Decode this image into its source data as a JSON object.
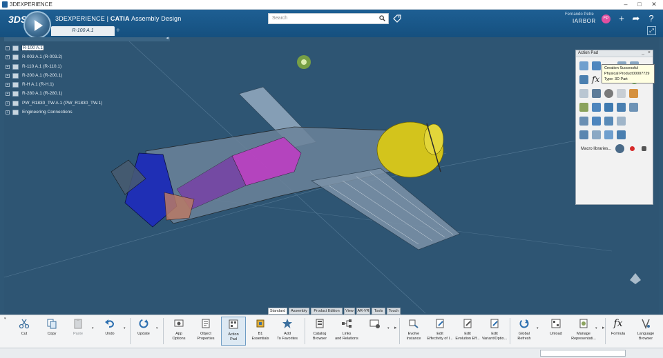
{
  "window": {
    "title": "3DEXPERIENCE"
  },
  "header": {
    "brand": "3DEXPERIENCE",
    "app_sep": " | ",
    "app": "CATIA",
    "app_module": "Assembly Design",
    "search_placeholder": "Search",
    "user_name": "Fernando Petre",
    "user_context": "IARBOR",
    "avatar_initials": "FP"
  },
  "tabs": [
    {
      "label": "R-100 A.1"
    }
  ],
  "tree": {
    "items": [
      {
        "label": "R-100 A.1",
        "selected": true
      },
      {
        "label": "R-003 A.1 (R-003.2)"
      },
      {
        "label": "R-110 A.1 (R-110.1)"
      },
      {
        "label": "R-200 A.1 (R-200.1)"
      },
      {
        "label": "R-H A.1 (R-H.1)"
      },
      {
        "label": "R-280 A.1 (R-280.1)"
      },
      {
        "label": "PW_R1830_TW A.1 (PW_R1830_TW.1)"
      },
      {
        "label": "Engineering Connections"
      }
    ]
  },
  "action_pad": {
    "title": "Action Pad",
    "macro_label": "Macro libraries...",
    "tooltip": [
      "Creation Successful",
      "Physical Product00007729",
      "Type: 3D Part"
    ]
  },
  "bottom_tabs": [
    "Standard",
    "Assembly",
    "Product Edition",
    "View",
    "AR-VR",
    "Tools",
    "Touch"
  ],
  "active_bottom_tab": "Standard",
  "toolbar": {
    "items": [
      {
        "label": "Cut",
        "icon": "scissors-icon"
      },
      {
        "label": "Copy",
        "icon": "copy-icon"
      },
      {
        "label": "Paste",
        "icon": "paste-icon",
        "disabled": true
      },
      {
        "label": "Undo",
        "icon": "undo-icon"
      },
      {
        "label": "Update",
        "icon": "update-icon"
      },
      {
        "label": "App\nOptions",
        "icon": "app-options-icon"
      },
      {
        "label": "Object\nProperties",
        "icon": "properties-icon"
      },
      {
        "label": "Action\nPad",
        "icon": "action-pad-icon",
        "active": true
      },
      {
        "label": "B1\nEssentials",
        "icon": "essentials-icon"
      },
      {
        "label": "Add\nTo Favorites",
        "icon": "star-icon"
      },
      {
        "label": "Catalog\nBrowser",
        "icon": "catalog-icon"
      },
      {
        "label": "Links\nand Relations",
        "icon": "links-icon"
      },
      {
        "label": "",
        "icon": "settings-grid-icon"
      },
      {
        "label": "Evolve\nInstance",
        "icon": "evolve-icon"
      },
      {
        "label": "Edit\nEffectivity of I...",
        "icon": "edit-effectivity-icon"
      },
      {
        "label": "Edit\nEvolution Eff...",
        "icon": "edit-evolution-icon"
      },
      {
        "label": "Edit\nVariant/Optio...",
        "icon": "edit-variant-icon"
      },
      {
        "label": "Global\nRefresh",
        "icon": "refresh-icon"
      },
      {
        "label": "Unload",
        "icon": "unload-icon"
      },
      {
        "label": "Manage\nRepresentati...",
        "icon": "manage-rep-icon"
      },
      {
        "label": "Formula",
        "icon": "formula-icon"
      },
      {
        "label": "Language\nBrowser",
        "icon": "language-icon"
      }
    ]
  },
  "colors": {
    "header": "#1b5a8c",
    "viewport": "#2e5573",
    "accent": "#e14fa0"
  }
}
